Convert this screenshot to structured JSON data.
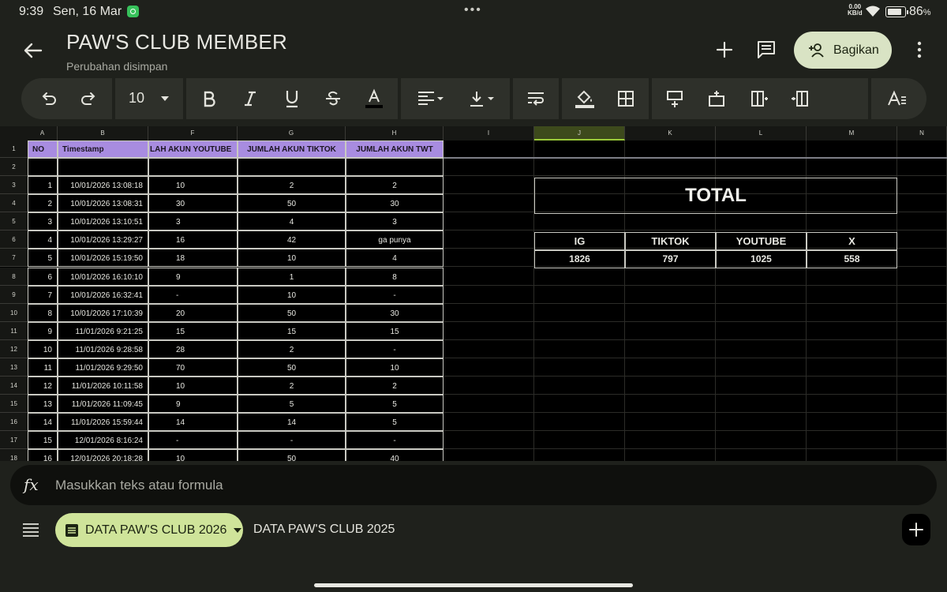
{
  "status": {
    "time": "9:39",
    "date": "Sen, 16 Mar",
    "net_speed_value": "0.00",
    "net_speed_unit": "KB/d",
    "battery": "86",
    "battery_unit": "%"
  },
  "header": {
    "title": "PAW'S CLUB MEMBER",
    "subtitle": "Perubahan disimpan",
    "share_label": "Bagikan"
  },
  "toolbar": {
    "font_size": "10"
  },
  "grid": {
    "columns": [
      "A",
      "B",
      "F",
      "G",
      "H",
      "I",
      "J",
      "K",
      "L",
      "M",
      "N"
    ],
    "rows": [
      "1",
      "2",
      "3",
      "4",
      "5",
      "6",
      "7",
      "8",
      "9",
      "10",
      "11",
      "12",
      "13",
      "14",
      "15",
      "16",
      "17",
      "18"
    ],
    "headers": [
      "NO",
      "Timestamp",
      "LAH AKUN YOUTUBE",
      "JUMLAH AKUN TIKTOK",
      "JUMLAH AKUN TWT"
    ],
    "data": [
      [
        "1",
        "10/01/2026 13:08:18",
        "10",
        "2",
        "2"
      ],
      [
        "2",
        "10/01/2026 13:08:31",
        "30",
        "50",
        "30"
      ],
      [
        "3",
        "10/01/2026 13:10:51",
        "3",
        "4",
        "3"
      ],
      [
        "4",
        "10/01/2026 13:29:27",
        "16",
        "42",
        "ga punya"
      ],
      [
        "5",
        "10/01/2026 15:19:50",
        "18",
        "10",
        "4"
      ],
      [
        "6",
        "10/01/2026 16:10:10",
        "9",
        "1",
        "8"
      ],
      [
        "7",
        "10/01/2026 16:32:41",
        "-",
        "10",
        "-"
      ],
      [
        "8",
        "10/01/2026 17:10:39",
        "20",
        "50",
        "30"
      ],
      [
        "9",
        "11/01/2026 9:21:25",
        "15",
        "15",
        "15"
      ],
      [
        "10",
        "11/01/2026 9:28:58",
        "28",
        "2",
        "-"
      ],
      [
        "11",
        "11/01/2026 9:29:50",
        "70",
        "50",
        "10"
      ],
      [
        "12",
        "11/01/2026 10:11:58",
        "10",
        "2",
        "2"
      ],
      [
        "13",
        "11/01/2026 11:09:45",
        "9",
        "5",
        "5"
      ],
      [
        "14",
        "11/01/2026 15:59:44",
        "14",
        "14",
        "5"
      ],
      [
        "15",
        "12/01/2026 8:16:24",
        "-",
        "-",
        "-"
      ],
      [
        "16",
        "12/01/2026 20:18:28",
        "10",
        "50",
        "40"
      ]
    ],
    "total": {
      "title": "TOTAL",
      "labels": [
        "IG",
        "TIKTOK",
        "YOUTUBE",
        "X"
      ],
      "values": [
        "1826",
        "797",
        "1025",
        "558"
      ]
    }
  },
  "formula_bar": {
    "fx_label": "fx",
    "placeholder": "Masukkan teks atau formula"
  },
  "sheets": {
    "active": "DATA PAW'S CLUB 2026",
    "other": "DATA PAW'S CLUB 2025"
  },
  "colors": {
    "header_fill": "#a88ce0",
    "active_tab": "#cfe49a",
    "share_button": "#d9e3c4",
    "selected_column": "#3d4a1c"
  }
}
